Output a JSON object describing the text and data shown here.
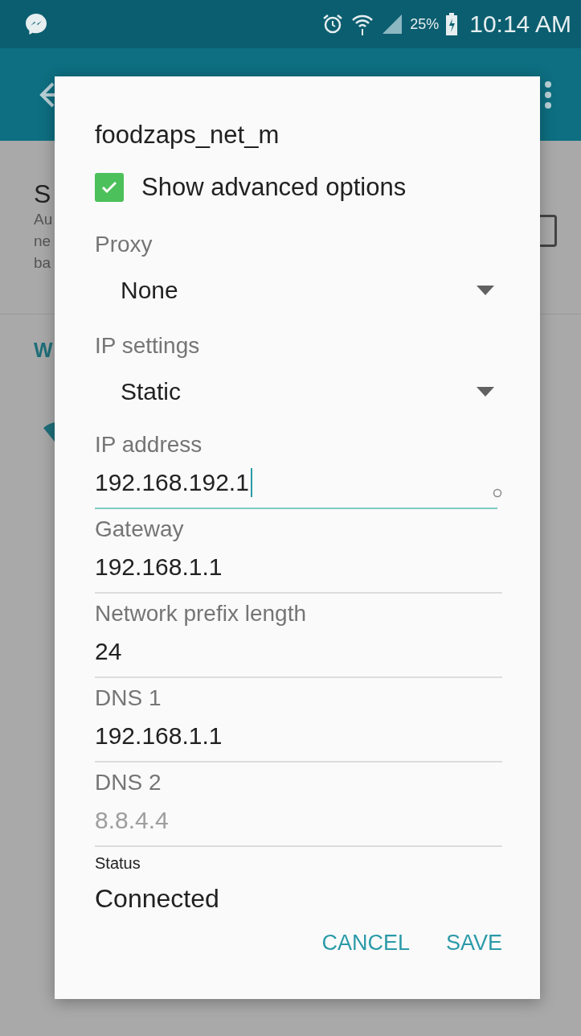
{
  "status_bar": {
    "battery": "25%",
    "time": "10:14 AM"
  },
  "background": {
    "section_title": "S",
    "summary_lines": [
      "Au",
      "ne",
      "ba"
    ],
    "list_header": "W"
  },
  "dialog": {
    "title": "foodzaps_net_m",
    "advanced_option": {
      "label": "Show advanced options",
      "checked": true
    },
    "dropdowns": [
      {
        "label": "Proxy",
        "value": "None"
      },
      {
        "label": "IP settings",
        "value": "Static"
      }
    ],
    "fields": [
      {
        "kind": "input",
        "label": "IP address",
        "value": "192.168.192.1",
        "focused": true
      },
      {
        "kind": "input",
        "label": "Gateway",
        "value": "192.168.1.1",
        "focused": false
      },
      {
        "kind": "input",
        "label": "Network prefix length",
        "value": "24",
        "focused": false
      },
      {
        "kind": "input",
        "label": "DNS 1",
        "value": "192.168.1.1",
        "focused": false
      },
      {
        "kind": "input",
        "label": "DNS 2",
        "placeholder": "8.8.4.4",
        "focused": false
      },
      {
        "kind": "info",
        "label": "Status",
        "value": "Connected"
      }
    ],
    "buttons": [
      {
        "label": "CANCEL"
      },
      {
        "label": "SAVE"
      }
    ]
  }
}
